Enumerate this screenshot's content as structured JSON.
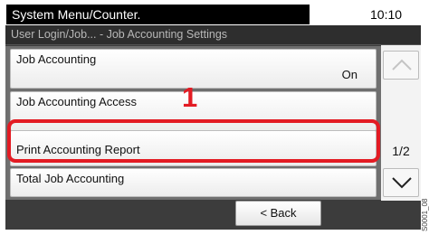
{
  "header": {
    "title": "System Menu/Counter.",
    "time": "10:10"
  },
  "breadcrumb": "User Login/Job... - Job Accounting Settings",
  "items": [
    {
      "label": "Job Accounting",
      "value": "On"
    },
    {
      "label": "Job Accounting Access",
      "value": ""
    },
    {
      "label": "Print Accounting Report",
      "value": ""
    },
    {
      "label": "Total Job Accounting",
      "value": ""
    }
  ],
  "pager": {
    "page": "1/2",
    "up_icon": "chevron-up-icon",
    "down_icon": "chevron-down-icon"
  },
  "footer": {
    "back_label": "< Back"
  },
  "annotation": {
    "step": "1",
    "highlight_color": "#e31b23"
  },
  "code": "S0001_08"
}
